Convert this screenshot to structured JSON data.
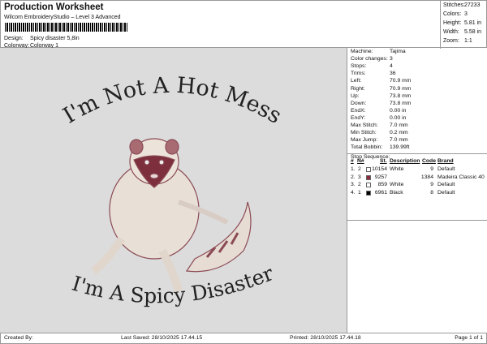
{
  "header": {
    "title": "Production Worksheet",
    "subtitle": "Wilcom EmbroideryStudio – Level 3 Advanced",
    "design_label": "Design:",
    "design_value": "Spicy disaster 5,8in",
    "colorway_label": "Colorway:",
    "colorway_value": "Colorway 1"
  },
  "stats": [
    {
      "label": "Stitches:",
      "value": "27233"
    },
    {
      "label": "Colors:",
      "value": "3"
    },
    {
      "label": "Height:",
      "value": "5.81 in"
    },
    {
      "label": "Width:",
      "value": "5.58 in"
    },
    {
      "label": "Zoom:",
      "value": "1:1"
    }
  ],
  "design_text": {
    "top": "I'm Not A Hot Mess",
    "bottom": "I'm A Spicy Disaster"
  },
  "machine_info": [
    {
      "label": "Machine:",
      "value": "Tajima"
    },
    {
      "label": "Color changes:",
      "value": "3"
    },
    {
      "label": "Stops:",
      "value": "4"
    },
    {
      "label": "Trims:",
      "value": "36"
    },
    {
      "label": "Left:",
      "value": "70.9 mm"
    },
    {
      "label": "Right:",
      "value": "70.9 mm"
    },
    {
      "label": "Up:",
      "value": "73.8 mm"
    },
    {
      "label": "Down:",
      "value": "73.8 mm"
    },
    {
      "label": "EndX:",
      "value": "0.00 in"
    },
    {
      "label": "EndY:",
      "value": "0.00 in"
    },
    {
      "label": "Max Stitch:",
      "value": "7.0 mm"
    },
    {
      "label": "Min Stitch:",
      "value": "0.2 mm"
    },
    {
      "label": "Max Jump:",
      "value": "7.0 mm"
    },
    {
      "label": "Total Bobbin:",
      "value": "139.99ft"
    }
  ],
  "stop_sequence": {
    "title": "Stop Sequence:",
    "headers": {
      "num": "#",
      "n": "N#",
      "st": "St.",
      "desc": "Description",
      "code": "Code",
      "brand": "Brand"
    },
    "rows": [
      {
        "num": "1.",
        "n": "2",
        "color": "#ffffff",
        "st": "10154",
        "desc": "White",
        "code": "9",
        "brand": "Default"
      },
      {
        "num": "2.",
        "n": "3",
        "color": "#8b2a3a",
        "st": "9257",
        "desc": "",
        "code": "1384",
        "brand": "Madeira Classic 40"
      },
      {
        "num": "3.",
        "n": "2",
        "color": "#ffffff",
        "st": "859",
        "desc": "White",
        "code": "9",
        "brand": "Default"
      },
      {
        "num": "4.",
        "n": "1",
        "color": "#000000",
        "st": "6961",
        "desc": "Black",
        "code": "8",
        "brand": "Default"
      }
    ]
  },
  "footer": {
    "created": "Created By:",
    "saved": "Last Saved: 28/10/2025 17.44.15",
    "printed": "Printed: 28/10/2025 17.44.18",
    "page": "Page 1 of 1"
  }
}
